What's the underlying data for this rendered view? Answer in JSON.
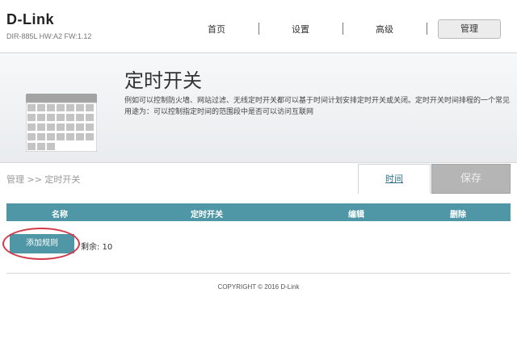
{
  "header": {
    "logo": "D-Link",
    "model": "DIR-885L HW:A2 FW:1.12",
    "nav": [
      "首页",
      "设置",
      "高级",
      "管理"
    ],
    "active_nav": "管理"
  },
  "banner": {
    "title": "定时开关",
    "description": "例如可以控制防火墙、网站过滤、无线定时开关都可以基于时间计划安排定时开关或关闭。定时开关时间排程的一个常见用途为：可以控制指定时间的范围段中是否可以访问互联网",
    "icon": "calendar-icon"
  },
  "toolbar": {
    "breadcrumb": "管理 >> 定时开关",
    "time_tab": "时间",
    "save_label": "保存"
  },
  "table": {
    "columns": [
      "名称",
      "定时开关",
      "编辑",
      "删除"
    ]
  },
  "actions": {
    "add_rule": "添加规则",
    "remaining": "剩余: 10"
  },
  "footer": {
    "copyright": "COPYRIGHT © 2016 D-Link"
  },
  "colors": {
    "accent": "#4f97a6",
    "highlight_ring": "#d13a4a",
    "save_disabled": "#b5b5b5"
  }
}
